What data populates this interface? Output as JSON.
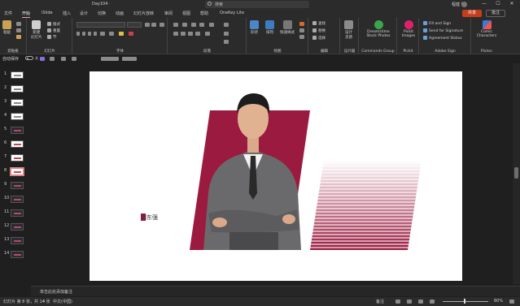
{
  "titlebar": {
    "doc_name": "Day104 ·",
    "search_placeholder": "搜索",
    "user_name": "程健 敏",
    "min_glyph": "—",
    "max_glyph": "☐",
    "close_glyph": "✕"
  },
  "tabs": [
    {
      "label": "文件"
    },
    {
      "label": "开始",
      "active": true
    },
    {
      "label": "iSlide"
    },
    {
      "label": "插入"
    },
    {
      "label": "设计"
    },
    {
      "label": "切换"
    },
    {
      "label": "动画"
    },
    {
      "label": "幻灯片放映"
    },
    {
      "label": "审阅"
    },
    {
      "label": "视图"
    },
    {
      "label": "帮助"
    },
    {
      "label": "OneKey Lite"
    }
  ],
  "share_label": "共享",
  "comment_label": "批注",
  "ribbon": {
    "clipboard": {
      "paste": "粘贴",
      "group": "剪贴板"
    },
    "slides": {
      "new_slide": "新建\n幻灯片",
      "layout": "版式",
      "reset": "重置",
      "section": "节",
      "group": "幻灯片"
    },
    "font": {
      "group": "字体"
    },
    "paragraph": {
      "group": "段落"
    },
    "drawing": {
      "shapes": "形状",
      "arrange": "排列",
      "quick_styles": "快速样式",
      "group": "绘图"
    },
    "editing": {
      "find": "查找",
      "replace": "替换",
      "select": "选择",
      "group": "编辑"
    },
    "designer": {
      "label": "设计\n灵感",
      "group": "设计器"
    },
    "dreamstime": {
      "label": "Dreamstime\nStock Photos",
      "group": "Commands Group"
    },
    "pickit": {
      "label": "Pickit\nImages",
      "group": "Pickit"
    },
    "adobe": {
      "fill_sign": "Fill and Sign",
      "send_sig": "Send for Signature",
      "agreement": "Agreement Status",
      "group": "Adobe Sign"
    },
    "pixton": {
      "label": "Comic\nCharacters",
      "group": "Pixton"
    }
  },
  "qat": {
    "autosave": "自动保存",
    "off": "关"
  },
  "thumbnails": [
    {
      "num": "1"
    },
    {
      "num": "2"
    },
    {
      "num": "3"
    },
    {
      "num": "4"
    },
    {
      "num": "5"
    },
    {
      "num": "6"
    },
    {
      "num": "7"
    },
    {
      "num": "8",
      "selected": true
    },
    {
      "num": "9"
    },
    {
      "num": "10"
    },
    {
      "num": "11"
    },
    {
      "num": "12"
    },
    {
      "num": "13"
    },
    {
      "num": "14"
    }
  ],
  "slide": {
    "name_text": "刘东强",
    "accent_color": "#9b1b40"
  },
  "notes_placeholder": "单击此处添加备注",
  "status": {
    "slide_info": "幻灯片 第 8 张，共 14 张",
    "language": "中文(中国)",
    "notes_btn": "备注",
    "zoom": "80%"
  }
}
